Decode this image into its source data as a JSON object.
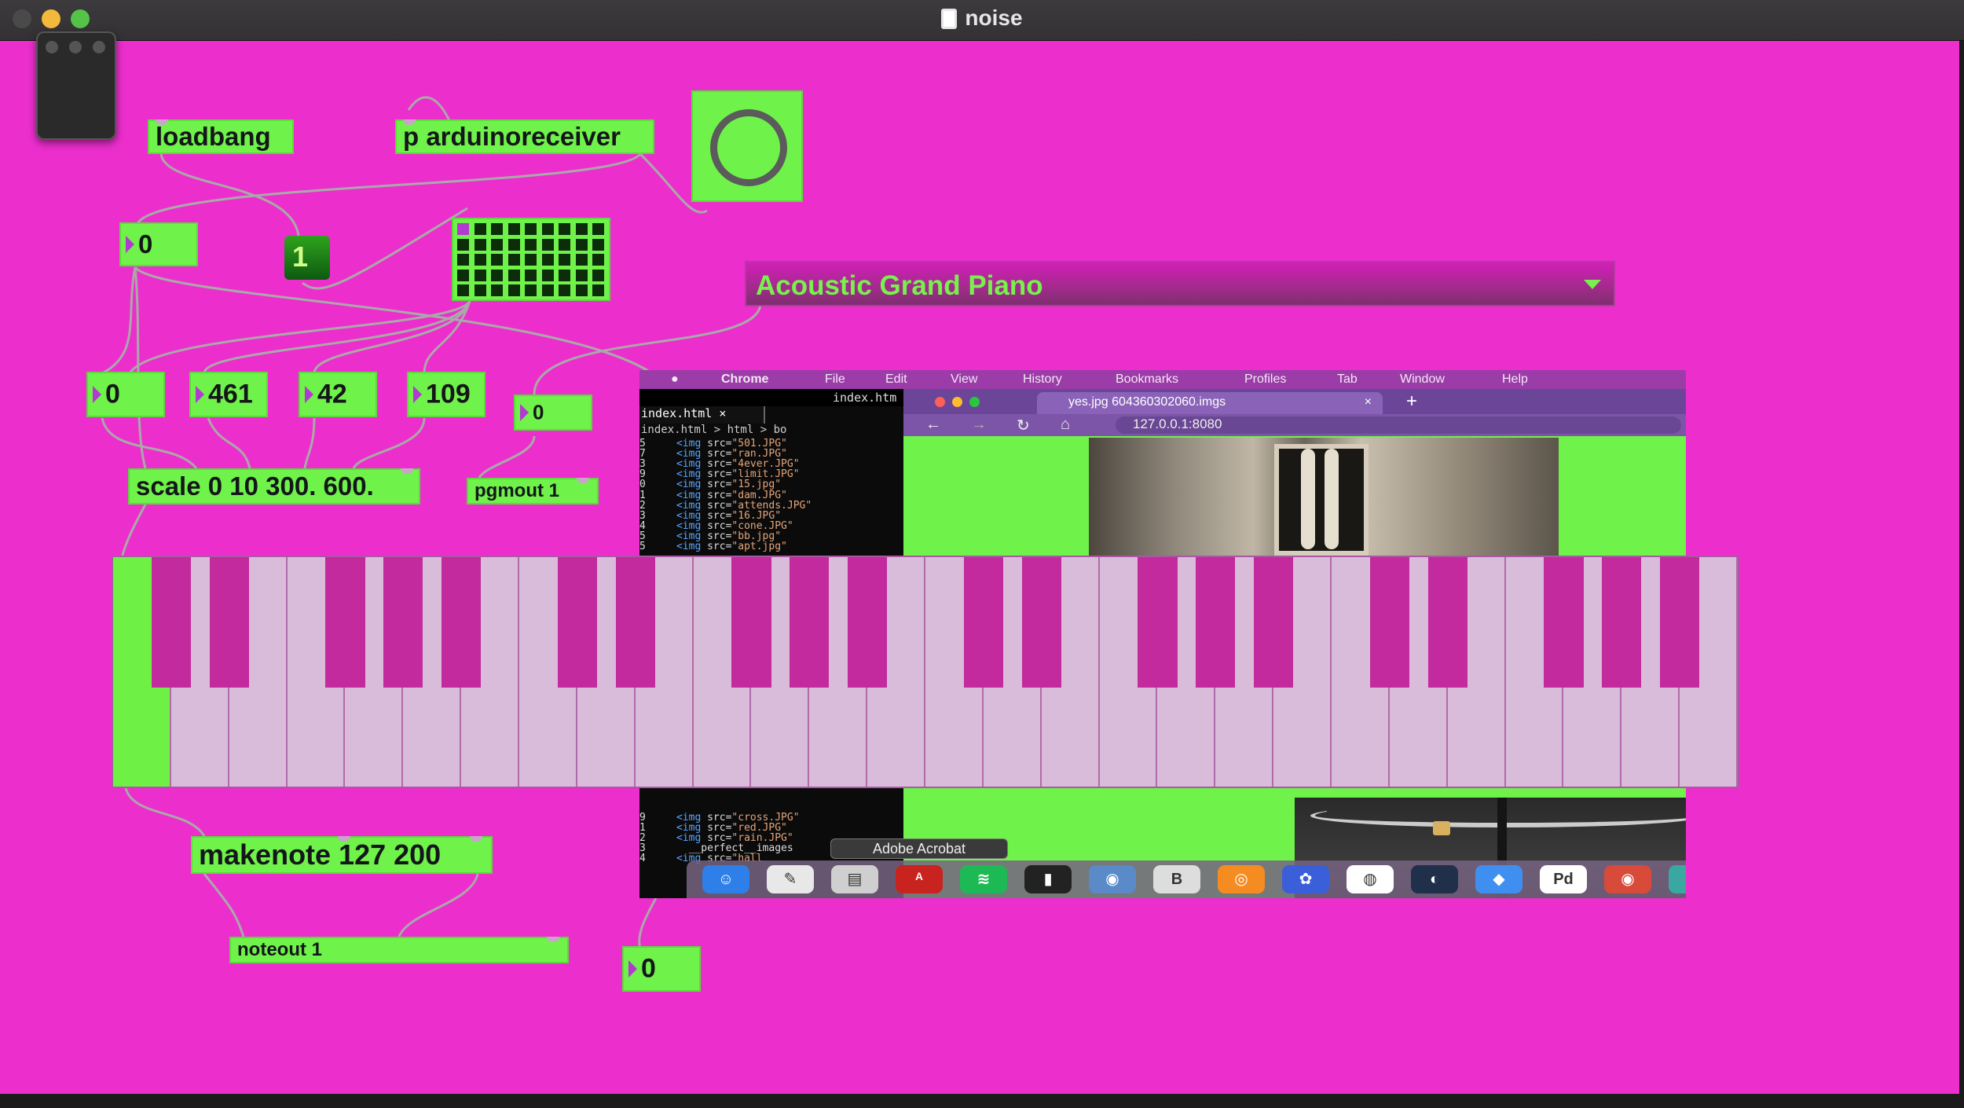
{
  "window": {
    "title": "noise"
  },
  "objects": {
    "loadbang": "loadbang",
    "arduino": "p arduinoreceiver",
    "scale": "scale 0 10 300. 600.",
    "pgmout": "pgmout 1",
    "makenote": "makenote 127 200",
    "noteout": "noteout 1",
    "toggle_value": "1"
  },
  "numbers": {
    "top_left": "0",
    "n1": "0",
    "n2": "461",
    "n3": "42",
    "n4": "109",
    "pgm": "0",
    "bottom": "0"
  },
  "instrument_menu": {
    "selected": "Acoustic Grand Piano"
  },
  "keyboard": {
    "pressed_key_index": 0
  },
  "embedded_screen": {
    "menubar": [
      "Chrome",
      "File",
      "Edit",
      "View",
      "History",
      "Bookmarks",
      "Profiles",
      "Tab",
      "Window",
      "Help"
    ],
    "editor_title": "index.htm",
    "editor_tab": "index.html",
    "breadcrumb": "index.html > html > bo",
    "code_top": [
      {
        "n": "5",
        "src": "\"501.JPG\""
      },
      {
        "n": "7",
        "src": "\"ran.JPG\""
      },
      {
        "n": "3",
        "src": "\"4ever.JPG\""
      },
      {
        "n": "9",
        "src": "\"limit.JPG\""
      },
      {
        "n": "0",
        "src": "\"15.jpg\""
      },
      {
        "n": "1",
        "src": "\"dam.JPG\""
      },
      {
        "n": "2",
        "src": "\"attends.JPG\""
      },
      {
        "n": "3",
        "src": "\"16.JPG\""
      },
      {
        "n": "4",
        "src": "\"cone.JPG\""
      },
      {
        "n": "5",
        "src": "\"bb.jpg\""
      },
      {
        "n": "5",
        "src": "\"apt.jpg\""
      }
    ],
    "code_bottom": [
      {
        "n": "9",
        "src": "\"cross.JPG\""
      },
      {
        "n": "1",
        "src": "\"red.JPG\""
      },
      {
        "n": "2",
        "src": "\"rain.JPG\""
      },
      {
        "n": "3",
        "text": "__perfect__images"
      },
      {
        "n": "4",
        "src": "\"hall"
      }
    ],
    "browser_tab": "yes.jpg 604360302060.imgs",
    "browser_url": "127.0.0.1:8080",
    "dock_tooltip": "Adobe Acrobat"
  },
  "colors": {
    "canvas": "#ec2ecd",
    "object_bg": "#6ff24a",
    "object_text": "#14161a",
    "white_key": "#d8bcd9",
    "black_key": "#c32a9e",
    "menu_text": "#78f14c"
  }
}
